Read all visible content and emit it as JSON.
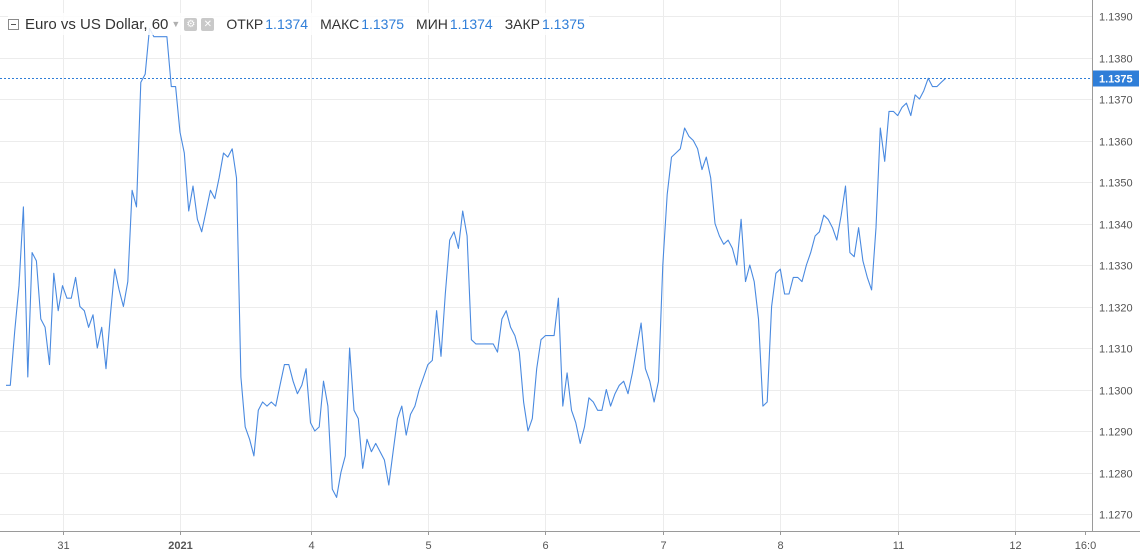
{
  "legend": {
    "symbol": "Euro vs US Dollar, 60",
    "open_label": "ОТКР",
    "open_value": "1.1374",
    "high_label": "МАКС",
    "high_value": "1.1375",
    "low_label": "МИН",
    "low_value": "1.1374",
    "close_label": "ЗАКР",
    "close_value": "1.1375",
    "icons": [
      "chevron-down-icon",
      "settings-icon",
      "close-icon"
    ]
  },
  "chart_data": {
    "type": "line",
    "line_color": "#4a8ae0",
    "last_value_badge_color": "#2f7ed8",
    "ylim": [
      1.1265,
      1.1393
    ],
    "y_ticks": [
      "1.1270",
      "1.1280",
      "1.1290",
      "1.1300",
      "1.1310",
      "1.1320",
      "1.1330",
      "1.1340",
      "1.1350",
      "1.1360",
      "1.1370",
      "1.1380",
      "1.1390"
    ],
    "last_value_label": "1.1375",
    "last_value": 1.1375,
    "x_ticks": [
      {
        "label": "31",
        "bar": 13,
        "bold": false
      },
      {
        "label": "2021",
        "bar": 40,
        "bold": true
      },
      {
        "label": "4",
        "bar": 70,
        "bold": false
      },
      {
        "label": "5",
        "bar": 97,
        "bold": false
      },
      {
        "label": "6",
        "bar": 124,
        "bold": false
      },
      {
        "label": "7",
        "bar": 151,
        "bold": false
      },
      {
        "label": "8",
        "bar": 178,
        "bold": false
      },
      {
        "label": "11",
        "bar": 205,
        "bold": false
      },
      {
        "label": "12",
        "bar": 232,
        "bold": false
      },
      {
        "label": "16:0",
        "bar": 248,
        "bold": false
      }
    ],
    "series": [
      {
        "values": [
          1.1301,
          1.1301,
          1.1314,
          1.1325,
          1.1344,
          1.1303,
          1.1333,
          1.1331,
          1.1317,
          1.1315,
          1.1306,
          1.1328,
          1.1319,
          1.1325,
          1.1322,
          1.1322,
          1.1327,
          1.132,
          1.1319,
          1.1315,
          1.1318,
          1.131,
          1.1315,
          1.1305,
          1.1318,
          1.1329,
          1.1324,
          1.132,
          1.1326,
          1.1348,
          1.1344,
          1.1374,
          1.1376,
          1.1387,
          1.1385,
          1.1385,
          1.1385,
          1.1385,
          1.1373,
          1.1373,
          1.1362,
          1.1357,
          1.1343,
          1.1349,
          1.1341,
          1.1338,
          1.1343,
          1.1348,
          1.1346,
          1.1351,
          1.1357,
          1.1356,
          1.1358,
          1.1351,
          1.1303,
          1.1291,
          1.1288,
          1.1284,
          1.1295,
          1.1297,
          1.1296,
          1.1297,
          1.1296,
          1.1301,
          1.1306,
          1.1306,
          1.1302,
          1.1299,
          1.1301,
          1.1305,
          1.1292,
          1.129,
          1.1291,
          1.1302,
          1.1296,
          1.1276,
          1.1274,
          1.128,
          1.1284,
          1.131,
          1.1295,
          1.1293,
          1.1281,
          1.1288,
          1.1285,
          1.1287,
          1.1285,
          1.1283,
          1.1277,
          1.1285,
          1.1293,
          1.1296,
          1.1289,
          1.1294,
          1.1296,
          1.13,
          1.1303,
          1.1306,
          1.1307,
          1.1319,
          1.1308,
          1.1323,
          1.1336,
          1.1338,
          1.1334,
          1.1343,
          1.1337,
          1.1312,
          1.1311,
          1.1311,
          1.1311,
          1.1311,
          1.1311,
          1.1309,
          1.1317,
          1.1319,
          1.1315,
          1.1313,
          1.1309,
          1.1297,
          1.129,
          1.1293,
          1.1305,
          1.1312,
          1.1313,
          1.1313,
          1.1313,
          1.1322,
          1.1296,
          1.1304,
          1.1295,
          1.1292,
          1.1287,
          1.1291,
          1.1298,
          1.1297,
          1.1295,
          1.1295,
          1.13,
          1.1296,
          1.1299,
          1.1301,
          1.1302,
          1.1299,
          1.1304,
          1.131,
          1.1316,
          1.1305,
          1.1302,
          1.1297,
          1.1302,
          1.133,
          1.1347,
          1.1356,
          1.1357,
          1.1358,
          1.1363,
          1.1361,
          1.136,
          1.1358,
          1.1353,
          1.1356,
          1.1351,
          1.134,
          1.1337,
          1.1335,
          1.1336,
          1.1334,
          1.133,
          1.1341,
          1.1326,
          1.133,
          1.1326,
          1.1317,
          1.1296,
          1.1297,
          1.132,
          1.1328,
          1.1329,
          1.1323,
          1.1323,
          1.1327,
          1.1327,
          1.1326,
          1.133,
          1.1333,
          1.1337,
          1.1338,
          1.1342,
          1.1341,
          1.1339,
          1.1336,
          1.1342,
          1.1349,
          1.1333,
          1.1332,
          1.1339,
          1.1331,
          1.1327,
          1.1324,
          1.1339,
          1.1363,
          1.1355,
          1.1367,
          1.1367,
          1.1366,
          1.1368,
          1.1369,
          1.1366,
          1.1371,
          1.137,
          1.1372,
          1.1375,
          1.1373,
          1.1373,
          1.1374,
          1.1375
        ]
      }
    ]
  }
}
